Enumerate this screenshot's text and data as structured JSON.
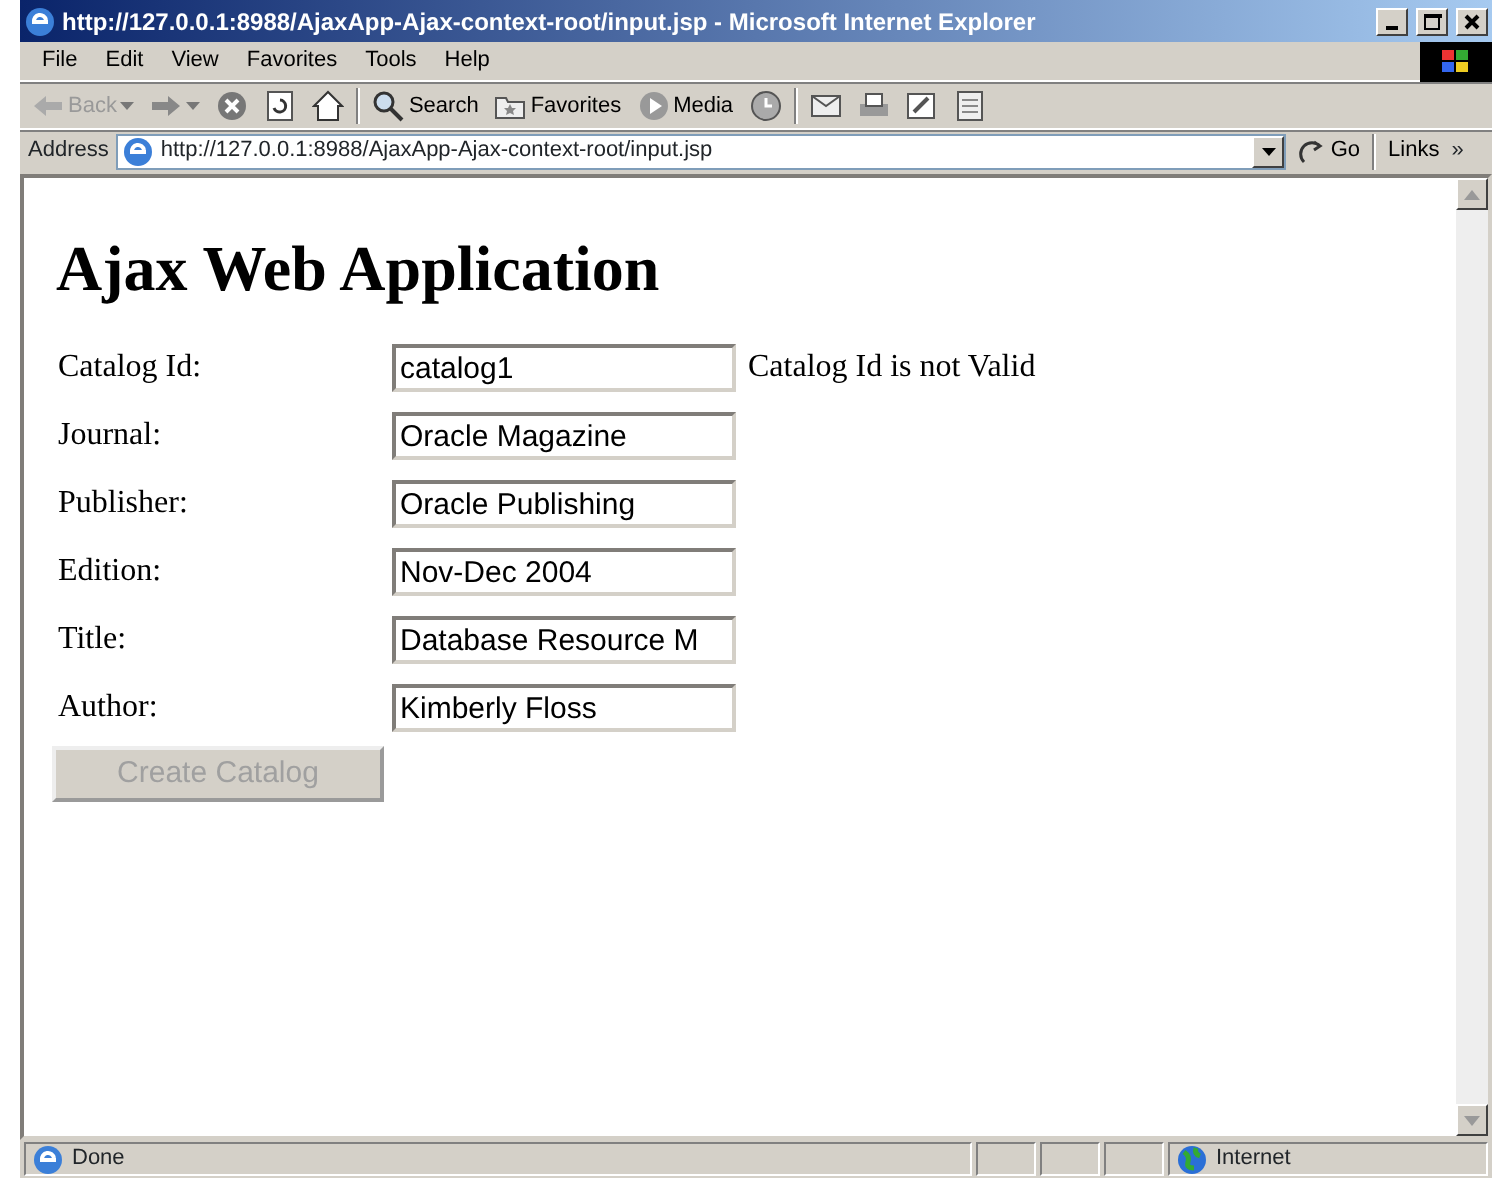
{
  "window": {
    "title": "http://127.0.0.1:8988/AjaxApp-Ajax-context-root/input.jsp - Microsoft Internet Explorer"
  },
  "menu": [
    "File",
    "Edit",
    "View",
    "Favorites",
    "Tools",
    "Help"
  ],
  "toolbar": [
    {
      "kind": "back",
      "label": "Back",
      "disabled": true
    },
    {
      "kind": "forward"
    },
    {
      "kind": "stop"
    },
    {
      "kind": "refresh"
    },
    {
      "kind": "home"
    },
    {
      "kind": "sep"
    },
    {
      "kind": "search",
      "label": "Search"
    },
    {
      "kind": "favorites",
      "label": "Favorites"
    },
    {
      "kind": "media",
      "label": "Media"
    },
    {
      "kind": "history"
    },
    {
      "kind": "sep"
    },
    {
      "kind": "mail"
    },
    {
      "kind": "print"
    },
    {
      "kind": "edit"
    },
    {
      "kind": "discuss"
    }
  ],
  "address": {
    "label": "Address",
    "url": "http://127.0.0.1:8988/AjaxApp-Ajax-context-root/input.jsp",
    "go": "Go",
    "links": "Links",
    "more": "»"
  },
  "page": {
    "heading": "Ajax Web Application",
    "fields": [
      {
        "label": "Catalog Id:",
        "value": "catalog1",
        "message": "Catalog Id is not Valid"
      },
      {
        "label": "Journal:",
        "value": "Oracle Magazine"
      },
      {
        "label": "Publisher:",
        "value": "Oracle Publishing"
      },
      {
        "label": "Edition:",
        "value": "Nov-Dec 2004"
      },
      {
        "label": "Title:",
        "value": "Database Resource M"
      },
      {
        "label": "Author:",
        "value": "Kimberly Floss"
      }
    ],
    "button": {
      "label": "Create Catalog",
      "disabled": true
    }
  },
  "status_bar": {
    "text": "Done",
    "zone": "Internet"
  }
}
